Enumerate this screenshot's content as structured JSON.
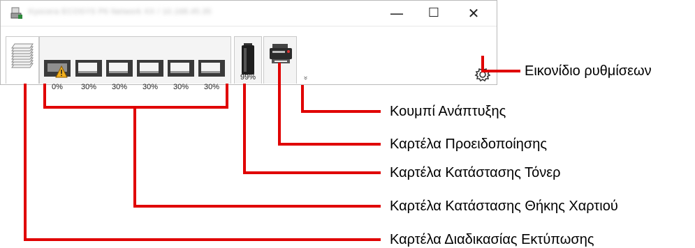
{
  "window": {
    "title": "Kyocera ECOSYS P6 Network XX / 10.168.45.35",
    "controls": {
      "minimize": "—",
      "maximize": "☐",
      "close": "✕"
    }
  },
  "trays": [
    {
      "percent": "0%",
      "warning": true
    },
    {
      "percent": "30%",
      "warning": false
    },
    {
      "percent": "30%",
      "warning": false
    },
    {
      "percent": "30%",
      "warning": false
    },
    {
      "percent": "30%",
      "warning": false
    },
    {
      "percent": "30%",
      "warning": false
    }
  ],
  "toner": {
    "percent": "99%"
  },
  "expand_button": "»",
  "annotations": {
    "settings_icon": "Εικονίδιο ρυθμίσεων",
    "expand_button": "Κουμπί Ανάπτυξης",
    "alert_tab": "Καρτέλα Προειδοποίησης",
    "toner_tab": "Καρτέλα Κατάστασης Τόνερ",
    "tray_tab": "Καρτέλα Κατάστασης Θήκης Χαρτιού",
    "print_tab": "Καρτέλα Διαδικασίας Εκτύπωσης"
  },
  "colors": {
    "annotation_line": "#e00000",
    "warning": "#f2b01e"
  }
}
